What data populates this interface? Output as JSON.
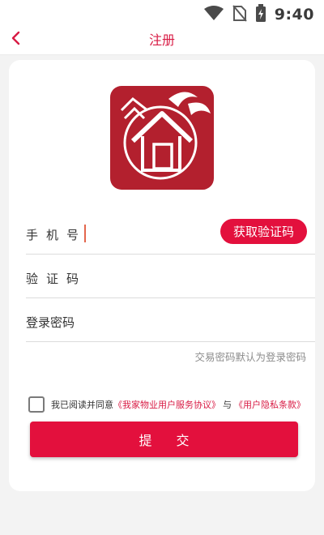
{
  "status_bar": {
    "time": "9:40",
    "icons": [
      "wifi-icon",
      "no-sim-icon",
      "battery-icon"
    ]
  },
  "nav": {
    "title": "注册",
    "back_icon": "chevron-left-icon"
  },
  "logo": {
    "icon": "house-logo-icon",
    "bg_color": "#b3202e"
  },
  "form": {
    "phone_label": "手机号",
    "get_code_label": "获取验证码",
    "code_label": "验证码",
    "password_label": "登录密码",
    "hint": "交易密码默认为登录密码"
  },
  "agreement": {
    "prefix": "我已阅读并同意",
    "service_link": "《我家物业用户服务协议》",
    "conjunction": "与",
    "privacy_link": "《用户隐私条款》",
    "checked": false
  },
  "submit_label": "提交",
  "colors": {
    "accent": "#e3103d",
    "title": "#d81b44",
    "background": "#f3f3f3"
  }
}
